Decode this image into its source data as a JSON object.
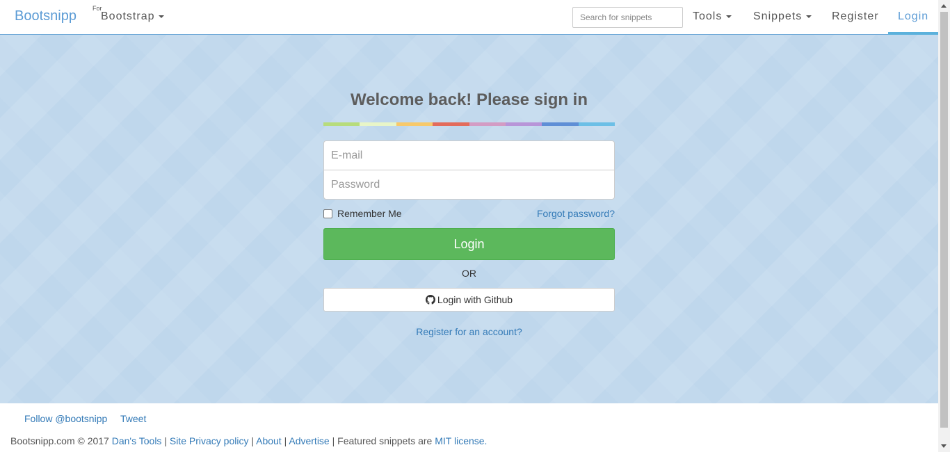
{
  "navbar": {
    "brand": "Bootsnipp",
    "for_label": "For",
    "bootstrap_label": "Bootstrap",
    "search_placeholder": "Search for snippets",
    "tools_label": "Tools",
    "snippets_label": "Snippets",
    "register_label": "Register",
    "login_label": "Login"
  },
  "form": {
    "title": "Welcome back! Please sign in",
    "rainbow_colors": [
      "#b7dc7c",
      "#e8f5c8",
      "#f7c96b",
      "#e36b5b",
      "#d39cc4",
      "#b895d8",
      "#5f8fd6",
      "#6cbfe6"
    ],
    "email_placeholder": "E-mail",
    "password_placeholder": "Password",
    "remember_label": "Remember Me",
    "remember_checked": false,
    "forgot_label": "Forgot password?",
    "login_button": "Login",
    "or_label": "OR",
    "github_button": "Login with Github",
    "register_link": "Register for an account?"
  },
  "footer": {
    "follow": "Follow @bootsnipp",
    "tweet": "Tweet",
    "copyright": "Bootsnipp.com © 2017",
    "dans_tools": "Dan's Tools",
    "privacy": "Site Privacy policy",
    "about": "About",
    "advertise": "Advertise",
    "featured": "Featured snippets are",
    "mit": "MIT license."
  },
  "colors": {
    "accent": "#5b9bd5",
    "link": "#337ab7",
    "success": "#5cb85c",
    "hero_bg": "#bfd7ec"
  }
}
